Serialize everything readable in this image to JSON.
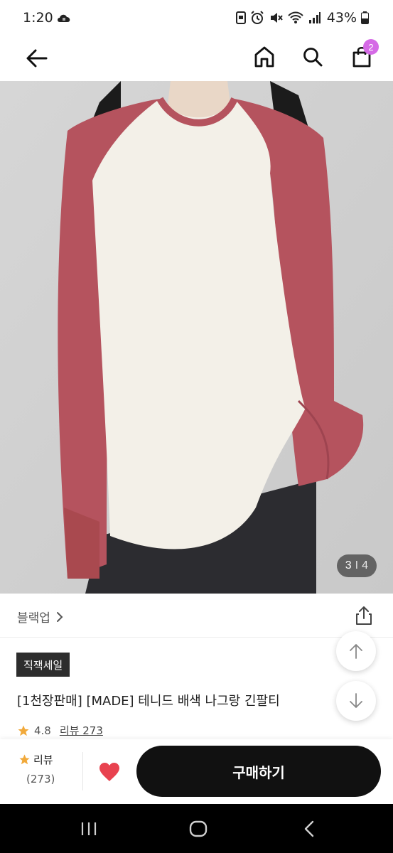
{
  "status_bar": {
    "time": "1:20",
    "battery": "43%",
    "icons": [
      "cloud-sync-icon",
      "screenshot-icon",
      "alarm-icon",
      "mute-icon",
      "wifi-icon",
      "signal-icon",
      "battery-icon"
    ]
  },
  "app_bar": {
    "cart_count": "2",
    "icons": [
      "back-arrow-icon",
      "home-icon",
      "search-icon",
      "shopping-bag-icon"
    ]
  },
  "product_image": {
    "current": "3",
    "separator": "I",
    "total": "4",
    "description_colors": {
      "body": "#f3f0e8",
      "sleeves": "#b5535e",
      "background": "#cfcfcf"
    }
  },
  "brand": {
    "name": "블랙업",
    "icons": [
      "chevron-right-icon",
      "share-icon"
    ]
  },
  "product": {
    "badge": "직잭세일",
    "title": "[1천장판매] [MADE] 테니드 배색 나그랑 긴팔티",
    "rating": "4.8",
    "review_link": "리뷰 273"
  },
  "purchase_bar": {
    "review_label": "리뷰",
    "review_count": "(273)",
    "buy_label": "구매하기",
    "colors": {
      "heart": "#e8424f",
      "buy_button": "#111111",
      "star": "#f1a93a"
    }
  }
}
